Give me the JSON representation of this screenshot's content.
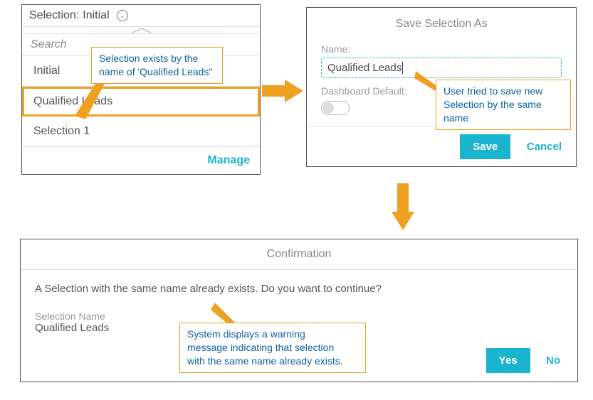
{
  "selection_panel": {
    "header_label": "Selection:",
    "header_value": "Initial",
    "search_placeholder": "Search",
    "items": [
      "Initial",
      "Qualified Leads",
      "Selection 1"
    ],
    "manage_label": "Manage"
  },
  "note1": {
    "text_line1": "Selection exists by the",
    "text_line2": "name of 'Qualified Leads\""
  },
  "save_dialog": {
    "title": "Save Selection As",
    "name_label": "Name:",
    "name_value": "Qualified Leads",
    "default_label": "Dashboard Default:",
    "save_label": "Save",
    "cancel_label": "Cancel"
  },
  "note2": {
    "text_line1": "User tried to save new",
    "text_line2": "Selection by the same",
    "text_line3": "name"
  },
  "confirmation": {
    "title": "Confirmation",
    "message": "A Selection with the same name already exists. Do you want to continue?",
    "field_label": "Selection Name",
    "field_value": "Qualified Leads",
    "yes_label": "Yes",
    "no_label": "No"
  },
  "note3": {
    "text_line1": "System displays a warning",
    "text_line2": "message indicating that selection",
    "text_line3": "with the same name already exists."
  }
}
